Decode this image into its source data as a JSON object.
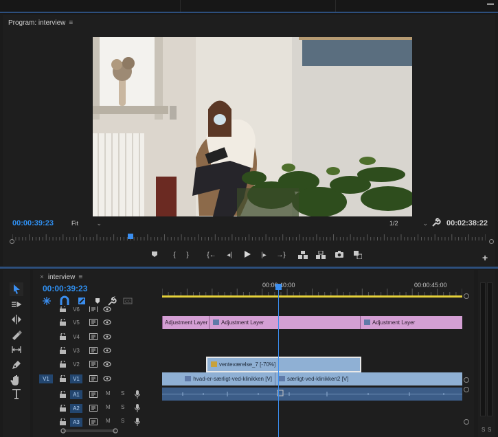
{
  "monitor": {
    "title": "Program: interview",
    "menu_glyph": "≡",
    "timecode": "00:00:39:23",
    "fit": "Fit",
    "resolution": "1/2",
    "duration": "00:02:38:22",
    "playhead_fraction": 0.25
  },
  "timeline": {
    "close_glyph": "×",
    "sequence_name": "interview",
    "menu_glyph": "≡",
    "timecode": "00:00:39:23",
    "ruler_labels": [
      "00:00:40:00",
      "00:00:45:00"
    ],
    "video_tracks": [
      {
        "label": "V6"
      },
      {
        "label": "V5"
      },
      {
        "label": "V4"
      },
      {
        "label": "V3"
      },
      {
        "label": "V2"
      },
      {
        "label": "V1",
        "source": "V1",
        "active": true
      }
    ],
    "audio_tracks": [
      {
        "label": "A1",
        "m": "M",
        "s": "S"
      },
      {
        "label": "A2",
        "m": "M",
        "s": "S"
      },
      {
        "label": "A3",
        "m": "M",
        "s": "S"
      }
    ],
    "clips": {
      "v5_adj_1": "Adjustment Layer",
      "v5_adj_2": "Adjustment Layer",
      "v5_adj_3": "Adjustment Layer",
      "v2_clip": "venteværelse_7 [-70%]",
      "v1_clip_1": "hvad-er-særligt-ved-klinikken [V]",
      "v1_clip_2": "særligt-ved-klinikken2 [V]"
    }
  },
  "meter": {
    "left": "S",
    "right": "S"
  },
  "icons": [
    "selection-tool-icon",
    "track-select-tool-icon",
    "ripple-edit-tool-icon",
    "razor-tool-icon",
    "slip-tool-icon",
    "pen-tool-icon",
    "hand-tool-icon",
    "type-tool-icon",
    "wrench-icon",
    "marker-icon",
    "lock-icon",
    "eye-icon",
    "mic-icon"
  ],
  "colors": {
    "accent": "#2f8ff0",
    "adjustment_clip": "#d49fd4",
    "video_clip": "#8fb0d4",
    "audio_clip": "#3c5d88",
    "work_area": "#e5d13a"
  }
}
